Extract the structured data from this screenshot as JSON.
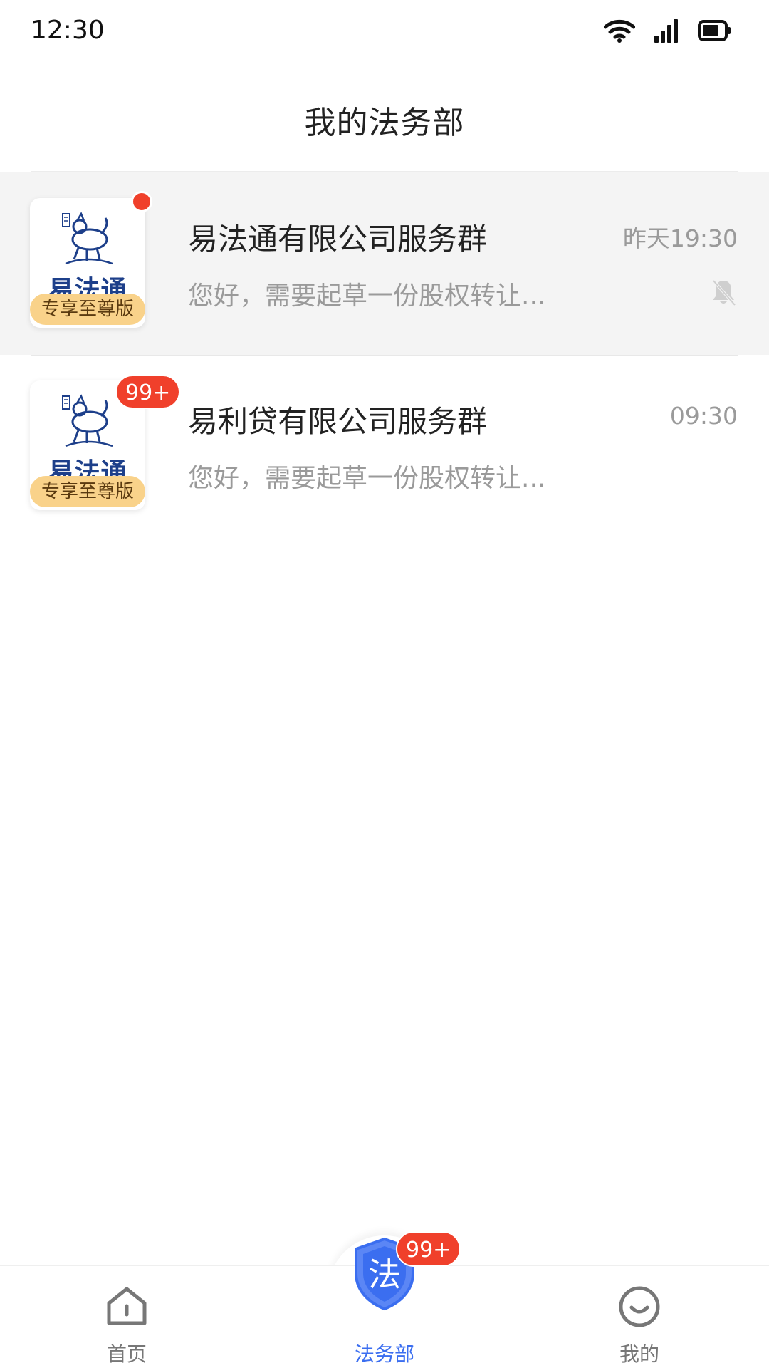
{
  "status_bar": {
    "time": "12:30",
    "icons": [
      "wifi-icon",
      "signal-icon",
      "battery-icon"
    ]
  },
  "header": {
    "title": "我的法务部"
  },
  "chats": [
    {
      "name": "易法通有限公司服务群",
      "time": "昨天19:30",
      "preview": "您好，需要起草一份股权转让...",
      "avatar_brand": "易法通",
      "avatar_tag": "专享至尊版",
      "unread": "dot",
      "muted": true,
      "highlighted": true
    },
    {
      "name": "易利贷有限公司服务群",
      "time": "09:30",
      "preview": "您好，需要起草一份股权转让...",
      "avatar_brand": "易法通",
      "avatar_tag": "专享至尊版",
      "unread_badge": "99+",
      "muted": false,
      "highlighted": false
    }
  ],
  "tabbar": {
    "tabs": [
      {
        "label": "首页",
        "icon": "home-icon",
        "active": false
      },
      {
        "label": "法务部",
        "icon": "shield-law-icon",
        "icon_char": "法",
        "active": true,
        "badge": "99+"
      },
      {
        "label": "我的",
        "icon": "smile-icon",
        "active": false
      }
    ]
  },
  "colors": {
    "accent": "#3b6ef0",
    "badge": "#f0402b",
    "tag_bg": "#f9d28a",
    "brand_blue": "#1d3f8a",
    "muted_text": "#9a9a9a"
  }
}
